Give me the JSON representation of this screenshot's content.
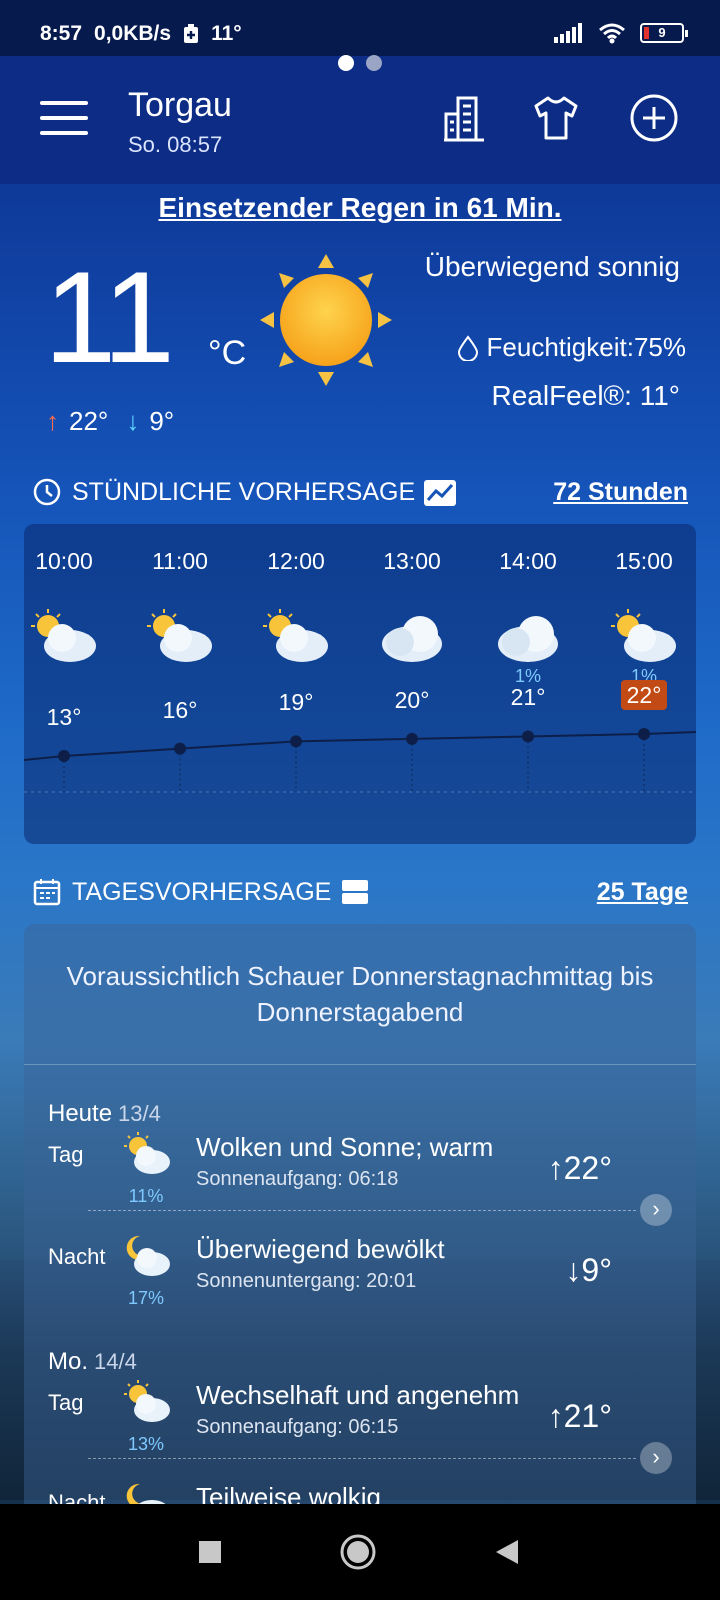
{
  "status_bar": {
    "time": "8:57",
    "speed": "0,0KB/s",
    "temp": "11°",
    "battery": "9"
  },
  "header": {
    "city": "Torgau",
    "datetime": "So. 08:57",
    "page_indicator": {
      "pages": 2,
      "active": 0
    }
  },
  "alert": "Einsetzender Regen in 61 Min.",
  "current": {
    "temp": "11",
    "unit": "°C",
    "high": "22°",
    "low": "9°",
    "condition": "Überwiegend sonnig",
    "humidity": "Feuchtigkeit:75%",
    "realfeel": "RealFeel®: 11°"
  },
  "hourly_section": {
    "title": "STÜNDLICHE VORHERSAGE",
    "link": "72 Stunden",
    "hours": [
      {
        "time": "10:00",
        "icon": "sun-cloud-icon",
        "precip": "",
        "temp": "13°",
        "value": 13
      },
      {
        "time": "11:00",
        "icon": "sun-cloud-icon",
        "precip": "",
        "temp": "16°",
        "value": 16
      },
      {
        "time": "12:00",
        "icon": "sun-cloud-icon",
        "precip": "",
        "temp": "19°",
        "value": 19
      },
      {
        "time": "13:00",
        "icon": "cloud-icon",
        "precip": "",
        "temp": "20°",
        "value": 20
      },
      {
        "time": "14:00",
        "icon": "cloud-icon",
        "precip": "1%",
        "temp": "21°",
        "value": 21
      },
      {
        "time": "15:00",
        "icon": "sun-cloud-icon",
        "precip": "1%",
        "temp": "22°",
        "value": 22,
        "highlight": true
      }
    ]
  },
  "daily_section": {
    "title": "TAGESVORHERSAGE",
    "link": "25 Tage",
    "summary": "Voraussichtlich Schauer Donnerstagnachmittag bis Donnerstagabend",
    "days": [
      {
        "name": "Heute",
        "date": "13/4",
        "day": {
          "label": "Tag",
          "desc": "Wolken und Sonne; warm",
          "sub": "Sonnenaufgang: 06:18",
          "precip": "11%",
          "temp": "↑22°"
        },
        "night": {
          "label": "Nacht",
          "desc": "Überwiegend bewölkt",
          "sub": "Sonnenuntergang: 20:01",
          "precip": "17%",
          "temp": "↓9°"
        }
      },
      {
        "name": "Mo.",
        "date": "14/4",
        "day": {
          "label": "Tag",
          "desc": "Wechselhaft und angenehm",
          "sub": "Sonnenaufgang: 06:15",
          "precip": "13%",
          "temp": "↑21°"
        },
        "night": {
          "label": "Nacht",
          "desc": "Teilweise wolkig",
          "sub": "",
          "precip": "",
          "temp": ""
        }
      }
    ]
  }
}
